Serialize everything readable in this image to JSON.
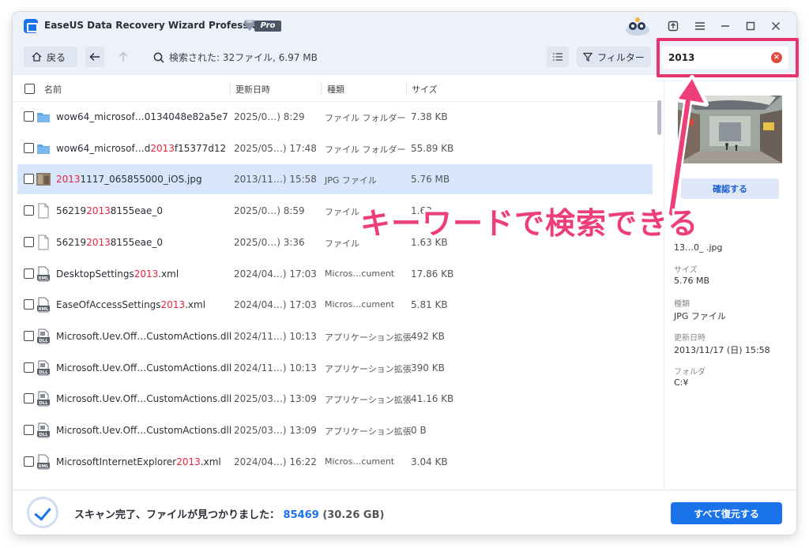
{
  "app": {
    "title": "EaseUS Data Recovery Wizard Professional",
    "badge": "Pro"
  },
  "toolbar": {
    "back_label": "戻る",
    "search_status": "検索された: 32ファイル, 6.97 MB",
    "filter_label": "フィルター",
    "search_value": "2013"
  },
  "list": {
    "headers": {
      "name": "名前",
      "date": "更新日時",
      "type": "種類",
      "size": "サイズ"
    },
    "rows": [
      {
        "icon": "folder-icon",
        "name_pre": "wow64_microsof…0134048e82a5e7",
        "name_hl": "",
        "name_post": "",
        "date": "2025/0…) 8:29",
        "type": "ファイル フォルダー",
        "size": "7.38 KB",
        "selected": false
      },
      {
        "icon": "folder-icon",
        "name_pre": "wow64_microsof…d",
        "name_hl": "2013",
        "name_post": "f15377d12",
        "date": "2025/05…) 17:48",
        "type": "ファイル フォルダー",
        "size": "55.89 KB",
        "selected": false
      },
      {
        "icon": "image-thumb-icon",
        "name_pre": "",
        "name_hl": "2013",
        "name_post": "1117_065855000_iOS.jpg",
        "date": "2013/11…) 15:58",
        "type": "JPG ファイル",
        "size": "5.76 MB",
        "selected": true
      },
      {
        "icon": "file-icon",
        "name_pre": "56219",
        "name_hl": "2013",
        "name_post": "8155eae_0",
        "date": "2025/0…) 8:59",
        "type": "ファイル",
        "size": "1.63",
        "selected": false
      },
      {
        "icon": "file-icon",
        "name_pre": "56219",
        "name_hl": "2013",
        "name_post": "8155eae_0",
        "date": "2025/0…) 3:36",
        "type": "ファイル",
        "size": "1.63 KB",
        "selected": false
      },
      {
        "icon": "xml-file-icon",
        "name_pre": "DesktopSettings",
        "name_hl": "2013",
        "name_post": ".xml",
        "date": "2024/04…) 17:03",
        "type": "Micros…cument",
        "size": "17.86 KB",
        "selected": false
      },
      {
        "icon": "xml-file-icon",
        "name_pre": "EaseOfAccessSettings",
        "name_hl": "2013",
        "name_post": ".xml",
        "date": "2024/04…) 17:03",
        "type": "Micros…cument",
        "size": "5.81 KB",
        "selected": false
      },
      {
        "icon": "dll-file-icon",
        "name_pre": "Microsoft.Uev.Off…CustomActions.dll",
        "name_hl": "",
        "name_post": "",
        "date": "2024/11…) 10:13",
        "type": "アプリケーション拡張",
        "size": "492 KB",
        "selected": false
      },
      {
        "icon": "dll-file-icon",
        "name_pre": "Microsoft.Uev.Off…CustomActions.dll",
        "name_hl": "",
        "name_post": "",
        "date": "2024/11…) 10:13",
        "type": "アプリケーション拡張",
        "size": "390 KB",
        "selected": false
      },
      {
        "icon": "dll-file-icon",
        "name_pre": "Microsoft.Uev.Off…CustomActions.dll",
        "name_hl": "",
        "name_post": "",
        "date": "2025/03…) 13:09",
        "type": "アプリケーション拡張",
        "size": "41.16 KB",
        "selected": false
      },
      {
        "icon": "dll-file-icon",
        "name_pre": "Microsoft.Uev.Off…CustomActions.dll",
        "name_hl": "",
        "name_post": "",
        "date": "2025/03…) 13:09",
        "type": "アプリケーション拡張",
        "size": "0 B",
        "selected": false
      },
      {
        "icon": "xml-file-icon",
        "name_pre": "MicrosoftInternetExplorer",
        "name_hl": "2013",
        "name_post": ".xml",
        "date": "2024/04…) 16:22",
        "type": "Micros…cument",
        "size": "3.04 KB",
        "selected": false
      }
    ]
  },
  "preview": {
    "confirm_label": "確認する",
    "name_value": "13…0_  .jpg",
    "size_label": "サイズ",
    "size_value": "5.76 MB",
    "type_label": "種類",
    "type_value": "JPG ファイル",
    "date_label": "更新日時",
    "date_value": "2013/11/17 (日) 15:58",
    "folder_label": "フォルダ",
    "folder_value": "C:¥"
  },
  "footer": {
    "status": "スキャン完了、ファイルが見つかりました：",
    "count": "85469",
    "total_size": "(30.26 GB)",
    "recover_all_label": "すべて復元する"
  },
  "annotation": {
    "callout": "キーワードで検索できる"
  },
  "colors": {
    "accent": "#1a73e8",
    "highlight": "#e8223b",
    "annotation": "#e8346e"
  }
}
